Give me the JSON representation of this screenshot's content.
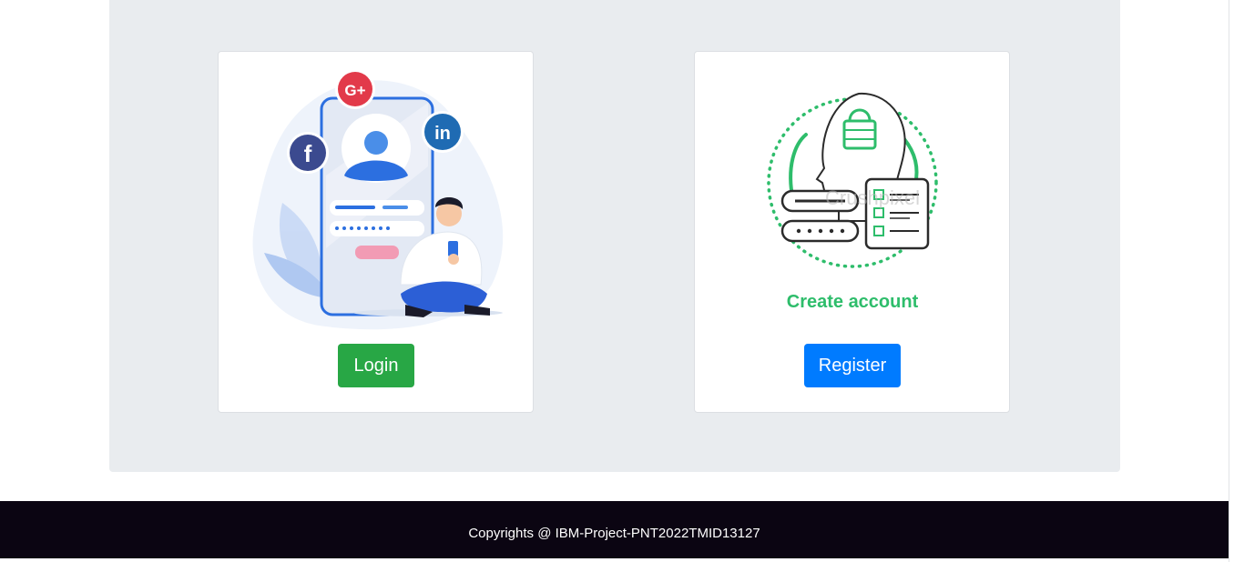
{
  "login_card": {
    "button_label": "Login",
    "illustration_icons": [
      "google-plus-icon",
      "facebook-icon",
      "linkedin-icon",
      "user-avatar-icon"
    ]
  },
  "register_card": {
    "caption": "Create account",
    "watermark": "Crushpixel",
    "button_label": "Register",
    "illustration_icons": [
      "head-padlock-icon",
      "password-field-icon",
      "checklist-icon"
    ]
  },
  "footer": {
    "text": "Copyrights @ IBM-Project-PNT2022TMID13127"
  },
  "colors": {
    "login_button": "#28a745",
    "register_button": "#007bff",
    "jumbotron_bg": "#e9ecef",
    "footer_bg": "#0b0512",
    "illustration_green": "#2ebd6b",
    "illustration_blue": "#2c6fe0"
  }
}
